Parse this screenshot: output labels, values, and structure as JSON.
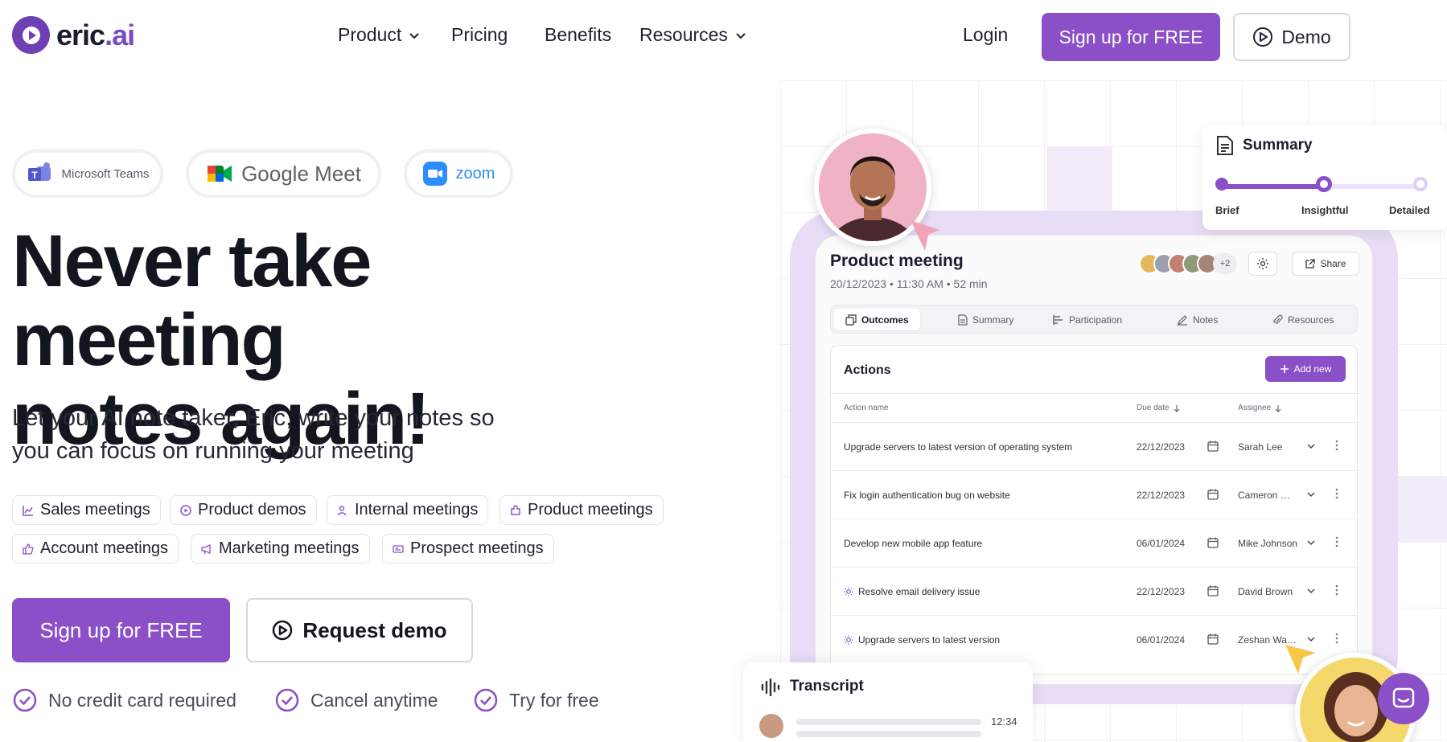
{
  "brand": {
    "logo_text": "eric",
    "logo_dot": ".ai"
  },
  "nav": {
    "product": "Product",
    "pricing": "Pricing",
    "benefits": "Benefits",
    "resources": "Resources",
    "login": "Login",
    "signup": "Sign up for FREE",
    "demo": "Demo"
  },
  "platforms": [
    "Microsoft Teams",
    "Google Meet",
    "zoom"
  ],
  "hero": {
    "title_line1": "Never take meeting",
    "title_line2": "notes again!",
    "subtitle_line1": "Let your AI note taker, Eric, write your notes so",
    "subtitle_line2": "you can focus on running your meeting"
  },
  "tags": [
    "Sales meetings",
    "Product demos",
    "Internal meetings",
    "Product meetings",
    "Account meetings",
    "Marketing meetings",
    "Prospect meetings"
  ],
  "cta": {
    "signup": "Sign up for FREE",
    "demo": "Request demo"
  },
  "checks": [
    "No credit card required",
    "Cancel anytime",
    "Try for free"
  ],
  "summary_card": {
    "title": "Summary",
    "levels": [
      "Brief",
      "Insightful",
      "Detailed"
    ],
    "selected": "Insightful"
  },
  "app": {
    "title": "Product meeting",
    "meta": "20/12/2023 • 11:30 AM • 52 min",
    "attendees_more": "+2",
    "share": "Share",
    "tabs": [
      "Outcomes",
      "Summary",
      "Participation",
      "Notes",
      "Resources"
    ],
    "active_tab": "Outcomes",
    "panel_title": "Actions",
    "add_new": "Add new",
    "columns": [
      "Action name",
      "Due date",
      "Assignee"
    ],
    "rows": [
      {
        "name": "Upgrade servers to latest version of operating system",
        "due": "22/12/2023",
        "assignee": "Sarah Lee"
      },
      {
        "name": "Fix login authentication bug on website",
        "due": "22/12/2023",
        "assignee": "Cameron Williamson"
      },
      {
        "name": "Develop new mobile app feature",
        "due": "06/01/2024",
        "assignee": "Mike Johnson"
      },
      {
        "name": "Resolve email delivery issue",
        "due": "22/12/2023",
        "assignee": "David Brown"
      },
      {
        "name": "Upgrade servers to latest version",
        "due": "06/01/2024",
        "assignee": "Zeshan Watson"
      }
    ]
  },
  "transcript": {
    "title": "Transcript",
    "time": "12:34"
  },
  "colors": {
    "accent": "#8b4fc8",
    "accent_light": "#e8dcf6",
    "text": "#14161f"
  }
}
